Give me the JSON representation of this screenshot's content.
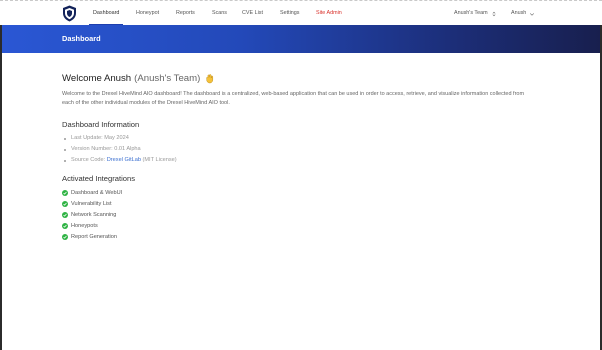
{
  "nav": {
    "items": [
      {
        "label": "Dashboard",
        "active": true
      },
      {
        "label": "Honeypot"
      },
      {
        "label": "Reports"
      },
      {
        "label": "Scans"
      },
      {
        "label": "CVE List"
      },
      {
        "label": "Settings"
      },
      {
        "label": "Site Admin",
        "color": "#d9312b"
      }
    ],
    "team_menu": "Anush's Team",
    "user_menu": "Anush"
  },
  "header": {
    "title": "Dashboard",
    "gradient": [
      "#2a57d4",
      "#181f4e"
    ]
  },
  "welcome": {
    "greeting": "Welcome Anush",
    "team": "(Anush's Team)",
    "intro": "Welcome to the Drexel HiveMind AIO dashboard! The dashboard is a centralized, web-based application that can be used in order to access, retrieve, and visualize information collected from each of the other individual modules of the Drexel HiveMind AIO tool."
  },
  "dashboard_info": {
    "heading": "Dashboard Information",
    "last_update": "Last Update: May 2024",
    "version": "Version Number: 0.01 Alpha",
    "source_prefix": "Source Code: ",
    "source_link": "Drexel GitLab",
    "source_suffix": " (MIT License)"
  },
  "integrations": {
    "heading": "Activated Integrations",
    "items": [
      "Dashboard & WebUI",
      "Vulnerability List",
      "Network Scanning",
      "Honeypots",
      "Report Generation"
    ],
    "check_color": "#2fb344"
  },
  "icons": {
    "logo": "shield-logo-icon",
    "chevron": "chevron-down-icon",
    "check": "check-circle-icon",
    "wave": "waving-hand-icon"
  }
}
